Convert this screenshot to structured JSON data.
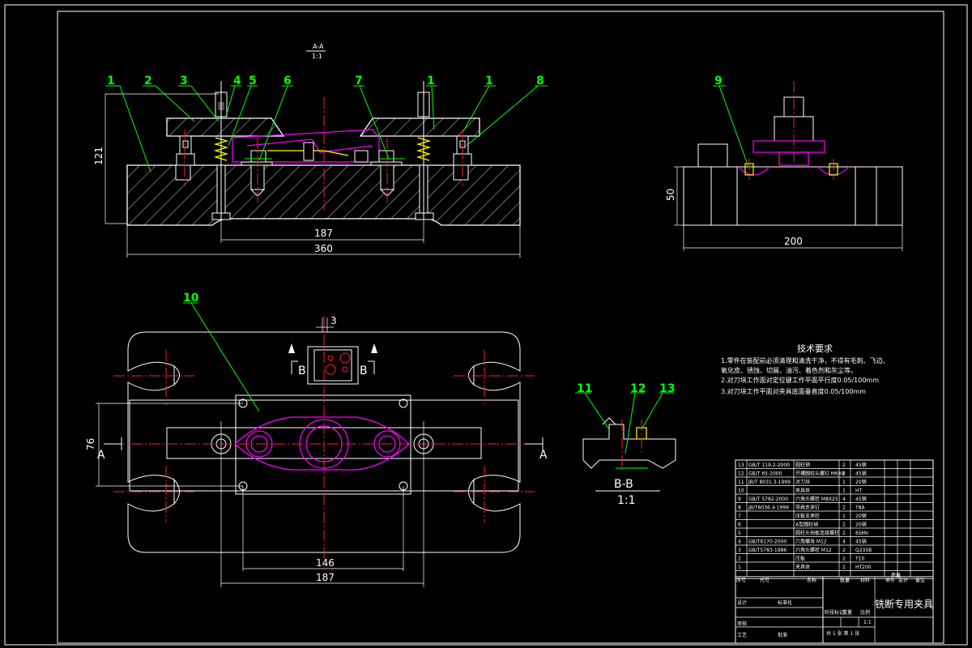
{
  "drawing": {
    "view_aa_title": "A-A",
    "view_aa_scale": "1:1",
    "view_bb_title": "B-B",
    "view_bb_scale": "1:1",
    "section_marks": {
      "a": "A",
      "b": "B"
    },
    "callouts": {
      "c1": "1",
      "c2": "2",
      "c3": "3",
      "c4": "4",
      "c5": "5",
      "c6": "6",
      "c7": "7",
      "c8": "8",
      "c9": "9",
      "c10": "10",
      "c11": "11",
      "c12": "12",
      "c13": "13"
    },
    "dimensions": {
      "height_121": "121",
      "span_187_front": "187",
      "length_360": "360",
      "height_50": "50",
      "width_200": "200",
      "offset_3": "3",
      "depth_76": "76",
      "span_146": "146",
      "span_187_top": "187"
    }
  },
  "tech_requirements": {
    "heading": "技术要求",
    "lines": [
      "1.零件在装配前必须清理和清洗干净，不得有毛刺、飞边、",
      "氧化皮、锈蚀、切屑、油污、着色剂和灰尘等。",
      "2.对刀块工作面对定位键工作平面平行度0.05/100mm",
      "3.对刀块工作平面对夹具底面垂直度0.05/100mm"
    ]
  },
  "bom": {
    "rows": [
      {
        "no": "13",
        "code": "GB/T 119.2-2000",
        "name": "圆柱销",
        "qty": "2",
        "material": "45钢"
      },
      {
        "no": "12",
        "code": "GB/T 65-2000",
        "name": "开槽圆柱头螺钉 M6X8",
        "qty": "2",
        "material": "45钢"
      },
      {
        "no": "11",
        "code": "JB/T 8031.3-1999",
        "name": "对刀块",
        "qty": "1",
        "material": "20钢"
      },
      {
        "no": "10",
        "code": "",
        "name": "夹具体",
        "qty": "1",
        "material": "HT"
      },
      {
        "no": "9",
        "code": "GB/T 5782-2000",
        "name": "六角头螺栓 M8X25",
        "qty": "4",
        "material": "45钢"
      },
      {
        "no": "8",
        "code": "JB/T8036.4-1999",
        "name": "带肩支承钉",
        "qty": "2",
        "material": "T8A"
      },
      {
        "no": "7",
        "code": "",
        "name": "压板支承柱",
        "qty": "1",
        "material": "20钢"
      },
      {
        "no": "6",
        "code": "",
        "name": "A型圆柱销",
        "qty": "2",
        "material": "20钢"
      },
      {
        "no": "5",
        "code": "",
        "name": "圆柱头挡板连接螺柱",
        "qty": "2",
        "material": "65Mn"
      },
      {
        "no": "4",
        "code": "GB/T6170-2000",
        "name": "六角螺母 M12",
        "qty": "4",
        "material": "45钢"
      },
      {
        "no": "3",
        "code": "GB/T5783-1986",
        "name": "六角头螺栓 M12",
        "qty": "2",
        "material": "Q235B"
      },
      {
        "no": "2",
        "code": "",
        "name": "压板",
        "qty": "2",
        "material": "T10"
      },
      {
        "no": "1",
        "code": "",
        "name": "夹具体",
        "qty": "1",
        "material": "HT200"
      }
    ],
    "header": {
      "no": "序号",
      "code": "代号",
      "name": "名称",
      "qty": "数量",
      "material": "材料",
      "unit_weight": "单件",
      "total_weight": "总计",
      "weight": "质量",
      "remark": "备注"
    }
  },
  "title_block": {
    "title": "铣断专用夹具",
    "scale_value": "1:1",
    "sheet_text": "共 1 张  第 1 张",
    "design_label": "设计",
    "review_label": "审核",
    "process_label": "工艺",
    "std_label": "标准化",
    "approve_label": "批准",
    "stage_label": "阶段标记",
    "weight_label": "重量",
    "scale_label": "比例"
  }
}
